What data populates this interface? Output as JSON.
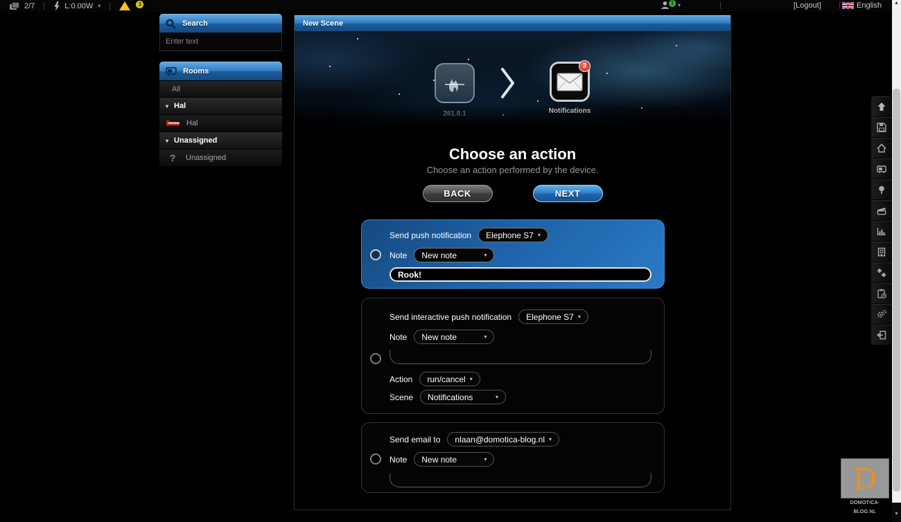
{
  "topbar": {
    "scene_counter": "2/7",
    "power_label": "L:0.00W",
    "warning_badge": "3",
    "user_badge": "1",
    "logout_label": "[Logout]",
    "language_label": "English"
  },
  "sidebar": {
    "search": {
      "title": "Search",
      "placeholder": "Enter text"
    },
    "rooms": {
      "title": "Rooms",
      "all_label": "All",
      "groups": [
        {
          "label": "Hal",
          "items": [
            {
              "label": "Hal",
              "icon": "bed-icon"
            }
          ]
        },
        {
          "label": "Unassigned",
          "items": [
            {
              "label": "Unassigned",
              "icon": "question-icon"
            }
          ]
        }
      ]
    }
  },
  "main": {
    "window_title": "New Scene",
    "banner": {
      "device_label": "261.0.1",
      "target_label": "Notifications",
      "target_badge": "3"
    },
    "heading": "Choose an action",
    "subheading": "Choose an action performed by the device.",
    "back_label": "BACK",
    "next_label": "NEXT",
    "actions": [
      {
        "title": "Send push notification",
        "device": "Elephone S7",
        "note_label": "Note",
        "note_value": "New note",
        "message": "Rook!"
      },
      {
        "title": "Send interactive push notification",
        "device": "Elephone S7",
        "note_label": "Note",
        "note_value": "New note",
        "message": "",
        "action_label": "Action",
        "action_value": "run/cancel",
        "scene_label": "Scene",
        "scene_value": "Notifications"
      },
      {
        "title": "Send email to",
        "device": "nlaan@domotica-blog.nl",
        "note_label": "Note",
        "note_value": "New note",
        "message": ""
      }
    ]
  },
  "toolbar": {
    "icons": [
      "scroll-up",
      "save",
      "home",
      "rooms",
      "status",
      "scenes",
      "charts",
      "devices",
      "plugins",
      "events",
      "settings",
      "exit"
    ]
  },
  "watermark": {
    "letter": "D",
    "label": "DOMOTICA-BLOG.NL"
  },
  "colors": {
    "accent_blue": "#2f7cc4",
    "selected_card_blue": "#1e62a8",
    "warning_yellow": "#f0c419",
    "badge_green": "#37b437",
    "badge_red": "#c62a1c",
    "logo_orange": "#e8921e"
  }
}
